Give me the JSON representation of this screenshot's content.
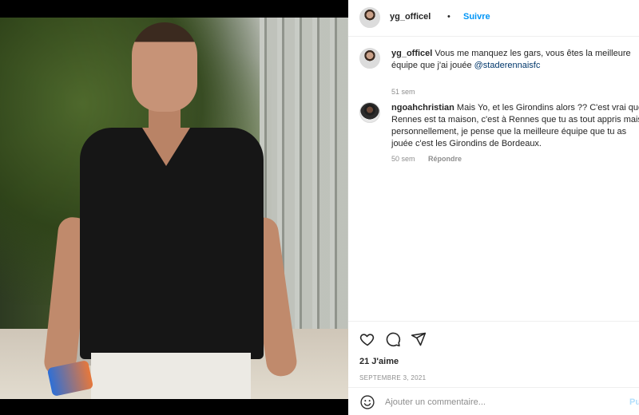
{
  "post": {
    "username": "yg_officel",
    "separator": "•",
    "follow_label": "Suivre"
  },
  "comments": [
    {
      "username": "yg_officel",
      "text": "Vous me manquez les gars, vous êtes la meilleure équipe que j'ai jouée",
      "mention": "@staderennaisfc",
      "time": "51 sem"
    },
    {
      "username": "ngoahchristian",
      "text": "Mais Yo, et les Girondins alors ?? C'est vrai que Rennes est ta maison, c'est à Rennes que tu as tout appris mais personnellement, je pense que la meilleure équipe que tu as jouée c'est les Girondins de Bordeaux.",
      "time": "50 sem",
      "reply_label": "Répondre"
    }
  ],
  "actions": {
    "icons": [
      "heart-icon",
      "comment-icon",
      "share-icon"
    ],
    "likes": "21 J'aime",
    "date": "SEPTEMBRE 3, 2021"
  },
  "composer": {
    "icon": "emoji-icon",
    "placeholder": "Ajouter un commentaire...",
    "post_label": "Pu"
  }
}
